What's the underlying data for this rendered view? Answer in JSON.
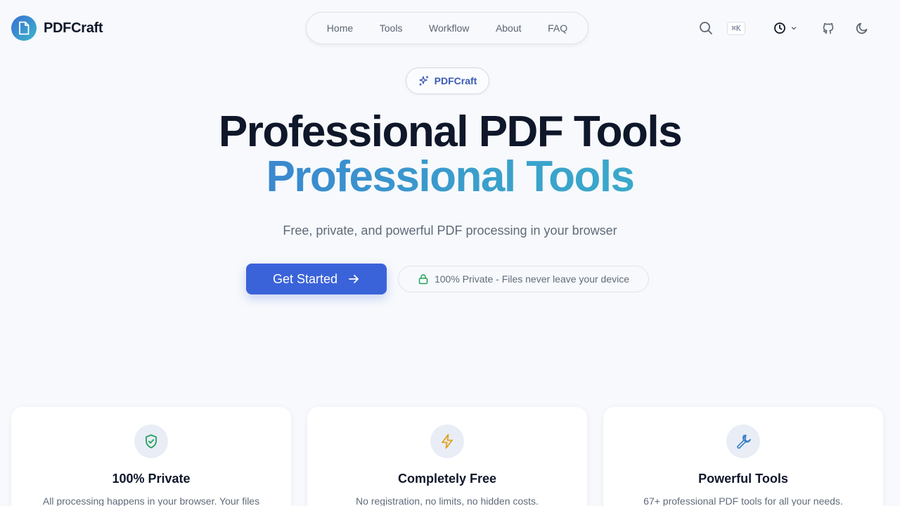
{
  "brand": {
    "name": "PDFCraft",
    "logo_icon": "document-icon"
  },
  "nav": {
    "items": [
      {
        "label": "Home"
      },
      {
        "label": "Tools"
      },
      {
        "label": "Workflow"
      },
      {
        "label": "About"
      },
      {
        "label": "FAQ"
      }
    ]
  },
  "toolbar": {
    "search_icon": "search-icon",
    "shortcut": "⌘K",
    "history_icon": "clock-icon",
    "github_icon": "github-icon",
    "theme_icon": "moon-icon"
  },
  "hero": {
    "badge": "PDFCraft",
    "title_line1": "Professional PDF Tools",
    "title_line2": "Professional Tools",
    "subtitle": "Free, private, and powerful PDF processing in your browser",
    "cta_label": "Get Started",
    "privacy_label": "100% Private - Files never leave your device"
  },
  "features": [
    {
      "title": "100% Private",
      "desc": "All processing happens in your browser. Your files",
      "icon": "shield-check-icon",
      "color": "#22a05b"
    },
    {
      "title": "Completely Free",
      "desc": "No registration, no limits, no hidden costs.",
      "icon": "lightning-icon",
      "color": "#e0a21b"
    },
    {
      "title": "Powerful Tools",
      "desc": "67+ professional PDF tools for all your needs.",
      "icon": "wrench-icon",
      "color": "#3b82c4"
    }
  ],
  "colors": {
    "accent": "#3b63d9",
    "text": "#0f172a",
    "muted": "#5f6b7a",
    "background": "#f7f9fc"
  }
}
